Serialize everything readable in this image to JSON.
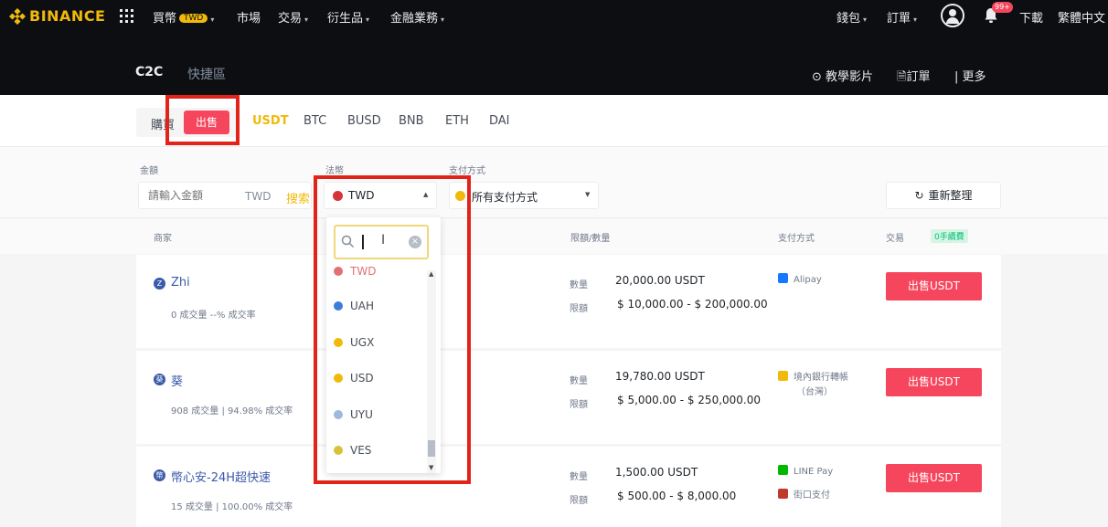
{
  "topnav": {
    "logo": "BINANCE",
    "items": [
      {
        "label": "買幣",
        "badge": "TWD",
        "caret": "▾"
      },
      {
        "label": "市場",
        "caret": ""
      },
      {
        "label": "交易",
        "caret": "▾"
      },
      {
        "label": "衍生品",
        "caret": "▾"
      },
      {
        "label": "金融業務",
        "caret": "▾"
      }
    ],
    "right": {
      "wallet": "錢包",
      "orders": "訂單",
      "notif_count": "99+",
      "download": "下載",
      "language": "繁體中文"
    }
  },
  "subheader": {
    "tabs": [
      {
        "label": "C2C"
      },
      {
        "label": "快捷區"
      }
    ],
    "tutorial": "教學影片",
    "orders": "訂單",
    "more": "更多"
  },
  "trade_side": {
    "buy": "購買",
    "sell": "出售"
  },
  "coins": [
    "USDT",
    "BTC",
    "BUSD",
    "BNB",
    "ETH",
    "DAI"
  ],
  "filters": {
    "amount_label": "金額",
    "amount_placeholder": "請輸入金額",
    "amount_unit": "TWD",
    "amount_search": "搜索",
    "fiat_label": "法幣",
    "fiat_value": "TWD",
    "payment_label": "支付方式",
    "payment_value": "所有支付方式",
    "refresh": "重新整理"
  },
  "table": {
    "headers": {
      "merchant": "商家",
      "price_qty": "限額/數量",
      "payment": "支付方式",
      "trade": "交易",
      "zero_fee": "0手續費"
    },
    "qty_label": "數量",
    "limit_label": "限額",
    "rows": [
      {
        "initial": "Z",
        "name": "Zhi",
        "stats": "0 成交量  --% 成交率",
        "quantity": "20,000.00 USDT",
        "limit": "$ 10,000.00 - $ 200,000.00",
        "payments": [
          {
            "label": "Alipay",
            "color": "#1677ff"
          }
        ],
        "action": "出售USDT"
      },
      {
        "initial": "葵",
        "name": "葵",
        "stats": "908 成交量 | 94.98% 成交率",
        "quantity": "19,780.00 USDT",
        "limit": "$ 5,000.00 - $ 250,000.00",
        "payments": [
          {
            "label": "境內銀行轉帳",
            "label2": "（台灣）",
            "color": "#f0b90b"
          }
        ],
        "action": "出售USDT"
      },
      {
        "initial": "幣",
        "name": "幣心安-24H超快速",
        "stats": "15 成交量 | 100.00% 成交率",
        "quantity": "1,500.00 USDT",
        "limit": "$ 500.00 - $ 8,000.00",
        "payments": [
          {
            "label": "LINE Pay",
            "color": "#00b900"
          },
          {
            "label": "街口支付",
            "color": "#c0392b"
          }
        ],
        "action": "出售USDT"
      }
    ]
  },
  "dropdown": {
    "search_value": "",
    "items": [
      {
        "code": "TWD",
        "color": "#d4343a"
      },
      {
        "code": "UAH",
        "color": "#3b7dd8"
      },
      {
        "code": "UGX",
        "color": "#f0b90b"
      },
      {
        "code": "USD",
        "color": "#f0b90b"
      },
      {
        "code": "UYU",
        "color": "#9fb8e0"
      },
      {
        "code": "VES",
        "color": "#d8c23a"
      }
    ]
  },
  "colors": {
    "brand": "#f0b90b",
    "sell": "#f6465d",
    "annotation": "#e2231a"
  }
}
